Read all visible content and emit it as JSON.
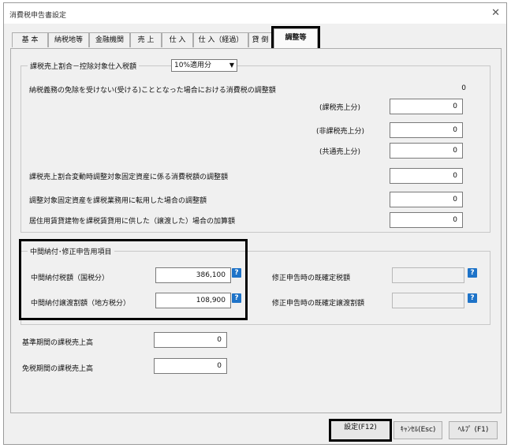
{
  "window": {
    "title": "消費税申告書設定"
  },
  "tabs": [
    {
      "label": "基 本"
    },
    {
      "label": "納税地等"
    },
    {
      "label": "金融機関"
    },
    {
      "label": "売 上"
    },
    {
      "label": "仕 入"
    },
    {
      "label": "仕 入（経過）"
    },
    {
      "label": "貸 倒"
    },
    {
      "label": "調整等"
    }
  ],
  "adjust": {
    "legend": "課税売上割合－控除対象仕入税額",
    "select_value": "10%適用分",
    "exempt_label": "納税義務の免除を受けない(受ける)こととなった場合における消費税の調整額",
    "exempt_value": "0",
    "sub_taxable_label": "(課税売上分)",
    "sub_taxable_value": "0",
    "sub_nontaxable_label": "(非課税売上分)",
    "sub_nontaxable_value": "0",
    "sub_common_label": "(共通売上分)",
    "sub_common_value": "0",
    "fluct_label": "課税売上割合変動時調整対象固定資産に係る消費税額の調整額",
    "fluct_value": "0",
    "conv_label": "調整対象固定資産を課税業務用に転用した場合の調整額",
    "conv_value": "0",
    "rental_label": "居住用賃貸建物を課税賃貸用に供した（譲渡した）場合の加算額",
    "rental_value": "0"
  },
  "interim": {
    "legend": "中間納付･修正申告用項目",
    "national_label": "中間納付税額（国税分）",
    "national_value": "386,100",
    "local_label": "中間納付譲渡割額（地方税分）",
    "local_value": "108,900",
    "amend_tax_label": "修正申告時の既確定税額",
    "amend_tax_value": "",
    "amend_transfer_label": "修正申告時の既確定譲渡割額",
    "amend_transfer_value": "",
    "help_glyph": "?"
  },
  "base": {
    "base_period_label": "基準期間の課税売上高",
    "base_period_value": "0",
    "exempt_period_label": "免税期間の課税売上高",
    "exempt_period_value": "0"
  },
  "buttons": {
    "ok": "設定(F12)",
    "cancel": "ｷｬﾝｾﾙ(Esc)",
    "help": "ﾍﾙﾌﾟ (F1)"
  },
  "icons": {
    "close": "close-icon",
    "help": "help-icon",
    "dropdown": "chevron-down-icon"
  }
}
